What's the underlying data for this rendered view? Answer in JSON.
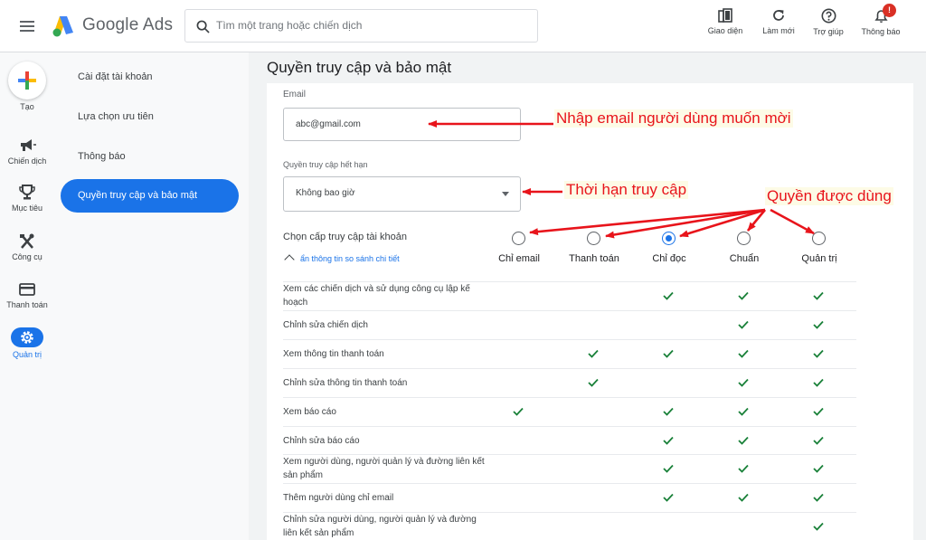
{
  "header": {
    "brand": "Google Ads",
    "search_placeholder": "Tìm một trang hoặc chiến dịch",
    "buttons": [
      {
        "label": "Giao diện",
        "icon": "layout-icon"
      },
      {
        "label": "Làm mới",
        "icon": "refresh-icon"
      },
      {
        "label": "Trợ giúp",
        "icon": "help-icon"
      },
      {
        "label": "Thông báo",
        "icon": "bell-icon",
        "badge": "!"
      }
    ]
  },
  "rail": {
    "create_label": "Tạo",
    "items": [
      {
        "label": "Chiến dịch",
        "icon": "megaphone-icon"
      },
      {
        "label": "Mục tiêu",
        "icon": "trophy-icon"
      },
      {
        "label": "Công cụ",
        "icon": "tools-icon"
      },
      {
        "label": "Thanh toán",
        "icon": "credit-card-icon"
      },
      {
        "label": "Quản trị",
        "icon": "gear-icon",
        "active": true
      }
    ]
  },
  "subnav": {
    "items": [
      "Cài đặt tài khoản",
      "Lựa chọn ưu tiên",
      "Thông báo"
    ],
    "active": "Quyền truy cập và bảo mật"
  },
  "page": {
    "title": "Quyền truy cập và bảo mật",
    "email_label": "Email",
    "email_value": "abc@gmail.com",
    "expiry_label": "Quyền truy cập hết hạn",
    "expiry_value": "Không bao giờ",
    "access_level_label": "Chọn cấp truy cập tài khoản",
    "toggle_label": "ẩn thông tin so sánh chi tiết",
    "levels": [
      "Chỉ email",
      "Thanh toán",
      "Chỉ đọc",
      "Chuẩn",
      "Quản trị"
    ],
    "selected_level": "Chỉ đọc"
  },
  "permissions": [
    {
      "text": "Xem các chiến dịch và sử dụng công cụ lập kế hoạch",
      "checks": [
        false,
        false,
        true,
        true,
        true
      ]
    },
    {
      "text": "Chỉnh sửa chiến dịch",
      "checks": [
        false,
        false,
        false,
        true,
        true
      ]
    },
    {
      "text": "Xem thông tin thanh toán",
      "checks": [
        false,
        true,
        true,
        true,
        true
      ]
    },
    {
      "text": "Chỉnh sửa thông tin thanh toán",
      "checks": [
        false,
        true,
        false,
        true,
        true
      ]
    },
    {
      "text": "Xem báo cáo",
      "checks": [
        true,
        false,
        true,
        true,
        true
      ]
    },
    {
      "text": "Chỉnh sửa báo cáo",
      "checks": [
        false,
        false,
        true,
        true,
        true
      ]
    },
    {
      "text": "Xem người dùng, người quản lý và đường liên kết sản phẩm",
      "checks": [
        false,
        false,
        true,
        true,
        true
      ]
    },
    {
      "text": "Thêm người dùng chỉ email",
      "checks": [
        false,
        false,
        true,
        true,
        true
      ]
    },
    {
      "text": "Chỉnh sửa người dùng, người quản lý và đường liên kết sản phẩm",
      "checks": [
        false,
        false,
        false,
        false,
        true
      ]
    }
  ],
  "annotations": {
    "email_note": "Nhập email người dùng muốn mời",
    "expiry_note": "Thời hạn truy cập",
    "rights_note": "Quyền được dùng",
    "color": "#e8141b"
  },
  "colors": {
    "accent": "#1a73e8",
    "check": "#188038"
  }
}
